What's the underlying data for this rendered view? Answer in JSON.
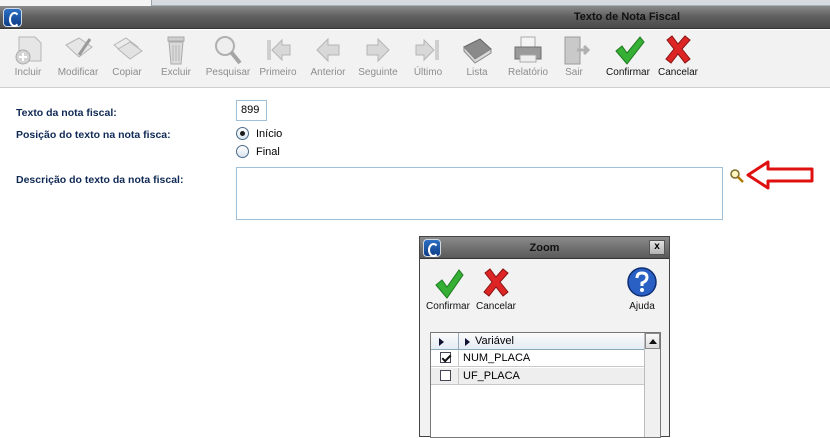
{
  "window": {
    "title": "Texto de Nota Fiscal"
  },
  "toolbar": {
    "items": [
      {
        "label": "Incluir",
        "icon": "add-document-icon",
        "enabled": false
      },
      {
        "label": "Modificar",
        "icon": "edit-document-icon",
        "enabled": false
      },
      {
        "label": "Copiar",
        "icon": "copy-documents-icon",
        "enabled": false
      },
      {
        "label": "Excluir",
        "icon": "trash-icon",
        "enabled": false
      },
      {
        "label": "Pesquisar",
        "icon": "magnifier-icon",
        "enabled": false
      },
      {
        "label": "Primeiro",
        "icon": "first-record-icon",
        "enabled": false
      },
      {
        "label": "Anterior",
        "icon": "previous-record-icon",
        "enabled": false
      },
      {
        "label": "Seguinte",
        "icon": "next-record-icon",
        "enabled": false
      },
      {
        "label": "Último",
        "icon": "last-record-icon",
        "enabled": false
      },
      {
        "label": "Lista",
        "icon": "book-list-icon",
        "enabled": false
      },
      {
        "label": "Relatório",
        "icon": "printer-icon",
        "enabled": false
      },
      {
        "label": "Sair",
        "icon": "exit-door-icon",
        "enabled": false
      },
      {
        "label": "Confirmar",
        "icon": "green-check-icon",
        "enabled": true
      },
      {
        "label": "Cancelar",
        "icon": "red-x-icon",
        "enabled": true
      }
    ]
  },
  "form": {
    "texto_label": "Texto da nota fiscal:",
    "texto_value": "899",
    "posicao_label": "Posição do texto na nota fisca:",
    "posicao_options": [
      "Início",
      "Final"
    ],
    "posicao_selected": "Início",
    "descricao_label": "Descrição do texto da nota fiscal:",
    "descricao_value": ""
  },
  "zoom_dialog": {
    "title": "Zoom",
    "close_label": "x",
    "buttons": {
      "confirmar": "Confirmar",
      "cancelar": "Cancelar",
      "ajuda": "Ajuda"
    },
    "column_header": "Variável",
    "rows": [
      {
        "value": "NUM_PLACA",
        "checked": true
      },
      {
        "value": "UF_PLACA",
        "checked": false
      }
    ]
  },
  "colors": {
    "annotation_arrow": "#e01010",
    "confirm": "#2fa82f",
    "cancel": "#d61f1f",
    "label_text": "#102a55"
  }
}
